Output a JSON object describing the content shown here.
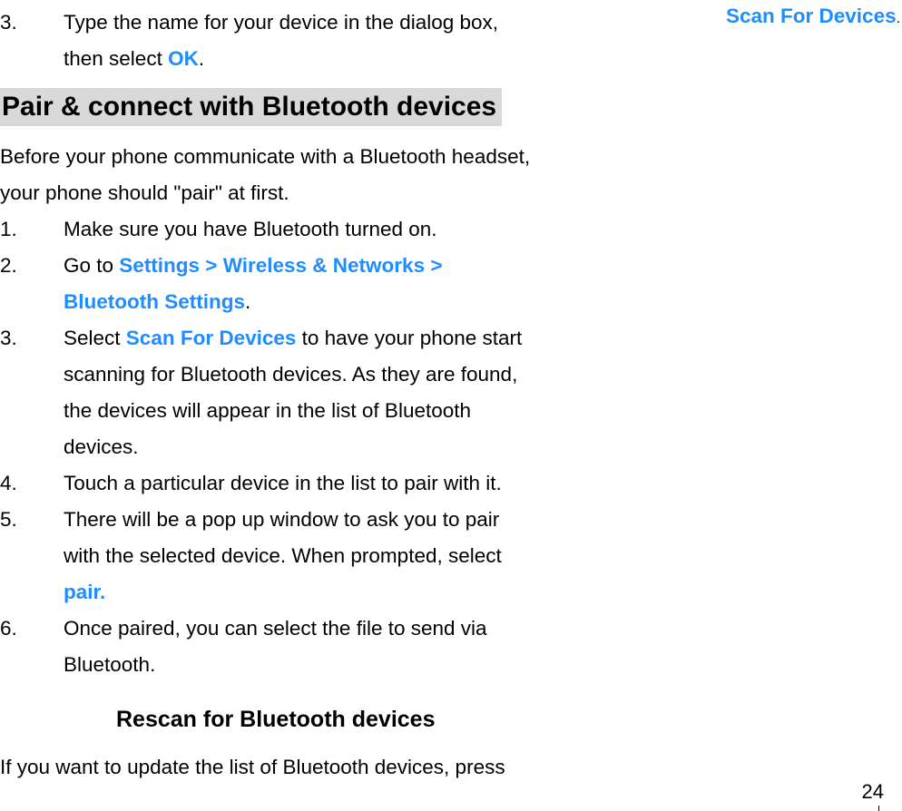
{
  "topItem": {
    "number": "3.",
    "text_before": "Type the name for your device in the dialog box, then select ",
    "link": "OK",
    "text_after": "."
  },
  "heading1": "Pair & connect with Bluetooth devices",
  "intro": "Before your phone communicate with a Bluetooth headset, your phone should \"pair\" at first.",
  "items": [
    {
      "number": "1.",
      "parts": [
        {
          "text": "Make sure you have Bluetooth turned on."
        }
      ]
    },
    {
      "number": "2.",
      "parts": [
        {
          "text": "Go to "
        },
        {
          "link": "Settings > Wireless & Networks > Bluetooth Settings"
        },
        {
          "text": "."
        }
      ]
    },
    {
      "number": "3.",
      "parts": [
        {
          "text": "Select "
        },
        {
          "link": "Scan For Devices"
        },
        {
          "text": " to have your phone start scanning for Bluetooth devices. As they are found, the devices will appear in the list of Bluetooth devices."
        }
      ]
    },
    {
      "number": "4.",
      "parts": [
        {
          "text": "Touch a particular device in the list to pair with it."
        }
      ]
    },
    {
      "number": "5.",
      "parts": [
        {
          "text": "There will be a pop up window to ask you to pair with the selected device. When prompted, select "
        },
        {
          "link": "pair."
        }
      ]
    },
    {
      "number": "6.",
      "parts": [
        {
          "text": "Once paired, you can select the file to send via Bluetooth."
        }
      ]
    }
  ],
  "heading2": "Rescan for Bluetooth devices",
  "closing": "If you want to update the list of Bluetooth devices, press",
  "rightColumn": {
    "link": "Scan For Devices",
    "period": "."
  },
  "pageNumber": "24"
}
